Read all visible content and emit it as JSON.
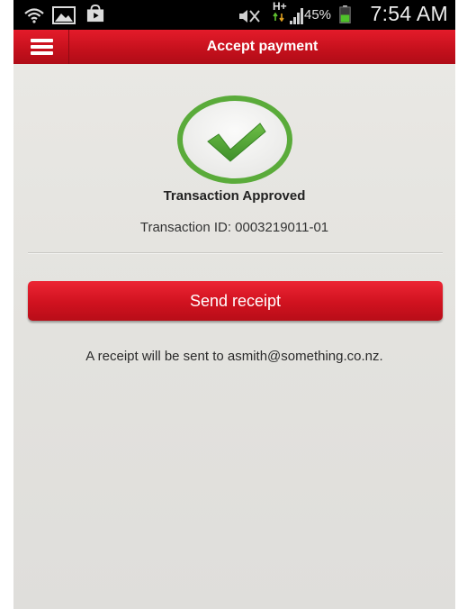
{
  "status_bar": {
    "battery_percent": "45%",
    "network_type": "H+",
    "clock": "7:54 AM",
    "icons": [
      "wifi-icon",
      "gallery-icon",
      "shopping-bag-icon",
      "mute-icon",
      "data-transfer-icon",
      "signal-icon",
      "battery-icon"
    ]
  },
  "header": {
    "title": "Accept payment",
    "menu_icon": "hamburger-menu-icon",
    "brand_color": "#d41624"
  },
  "result": {
    "icon": "checkmark-circle-icon",
    "icon_color": "#59ae3c",
    "title": "Transaction Approved",
    "transaction_id": "Transaction ID: 0003219011-01"
  },
  "actions": {
    "send_receipt_label": "Send receipt"
  },
  "receipt_note": "A receipt will be sent to asmith@something.co.nz."
}
